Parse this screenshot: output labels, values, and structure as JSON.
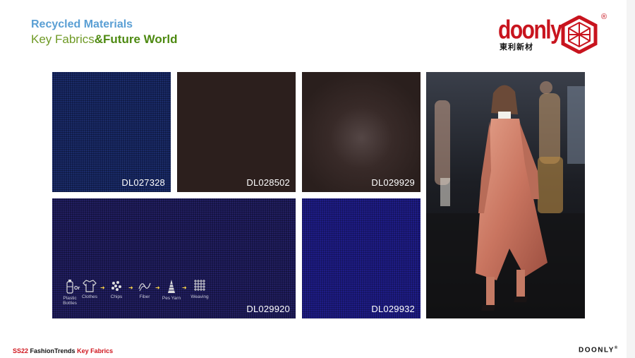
{
  "header": {
    "title": "Recycled Materials",
    "subtitle_part1": "Key Fabrics",
    "subtitle_part2": "&Future World"
  },
  "logo": {
    "word": "doonly",
    "cn_text": "東利新材",
    "registered": "®"
  },
  "swatches": [
    {
      "code": "DL027328",
      "color": "#14225a"
    },
    {
      "code": "DL028502",
      "color": "#2c1f1d"
    },
    {
      "code": "DL029929",
      "color": "#2a1f1d"
    },
    {
      "code": "DL029920",
      "color": "#1a1852"
    },
    {
      "code": "DL029932",
      "color": "#1e1c86"
    }
  ],
  "process": {
    "or_label": "Or",
    "steps": [
      {
        "label": "Plastic Bottles",
        "icon": "bottle-icon"
      },
      {
        "label": "Clothes",
        "icon": "shirt-icon"
      },
      {
        "label": "Chips",
        "icon": "chips-icon"
      },
      {
        "label": "Fiber",
        "icon": "fiber-icon"
      },
      {
        "label": "Pes Yarn",
        "icon": "yarn-icon"
      },
      {
        "label": "Weaving",
        "icon": "weaving-icon"
      }
    ],
    "arrow_color": "#ffd84a"
  },
  "footer": {
    "season": "SS22",
    "middle": "FashionTrends",
    "section": "Key Fabrics",
    "brand": "DOONLY",
    "brand_mark": "®"
  },
  "colors": {
    "title_blue": "#5a9fd4",
    "subtitle_green": "#6f9a26",
    "brand_red": "#c8141e"
  }
}
